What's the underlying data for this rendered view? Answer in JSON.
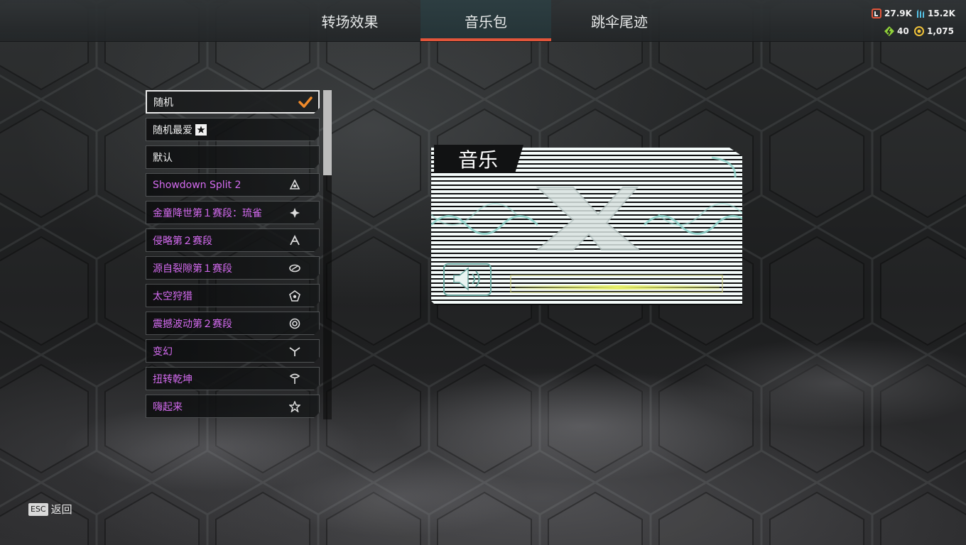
{
  "tabs": [
    {
      "label": "转场效果"
    },
    {
      "label": "音乐包"
    },
    {
      "label": "跳伞尾迹"
    }
  ],
  "currencies": {
    "legend_tokens": "27.9K",
    "crafting_metals": "15.2K",
    "heirloom_shards": "40",
    "apex_coins": "1,075"
  },
  "music_list": {
    "items": [
      {
        "label": "随机",
        "icon": "check-icon",
        "selected": true
      },
      {
        "label": "随机最爱",
        "icon": "favorite-star-icon"
      },
      {
        "label": "默认"
      },
      {
        "label": "Showdown Split 2",
        "icon": "season-badge-icon"
      },
      {
        "label": "金童降世第１赛段：琉雀",
        "icon": "season-badge-icon"
      },
      {
        "label": "侵略第２赛段",
        "icon": "season-badge-icon"
      },
      {
        "label": "源自裂隙第１赛段",
        "icon": "season-badge-icon"
      },
      {
        "label": "太空狩猎",
        "icon": "season-badge-icon"
      },
      {
        "label": "震撼波动第２赛段",
        "icon": "season-badge-icon"
      },
      {
        "label": "变幻",
        "icon": "season-badge-icon"
      },
      {
        "label": "扭转乾坤",
        "icon": "season-badge-icon"
      },
      {
        "label": "嗨起来",
        "icon": "season-badge-icon"
      }
    ]
  },
  "preview": {
    "title": "音乐",
    "emblem": "X",
    "icon": "speaker-icon"
  },
  "footer": {
    "key": "ESC",
    "label": "返回"
  },
  "colors": {
    "accent_orange": "#e2553a",
    "check_orange": "#f08a2a",
    "purple_text": "#d46bf0",
    "preview_teal": "#8fd6cc"
  }
}
